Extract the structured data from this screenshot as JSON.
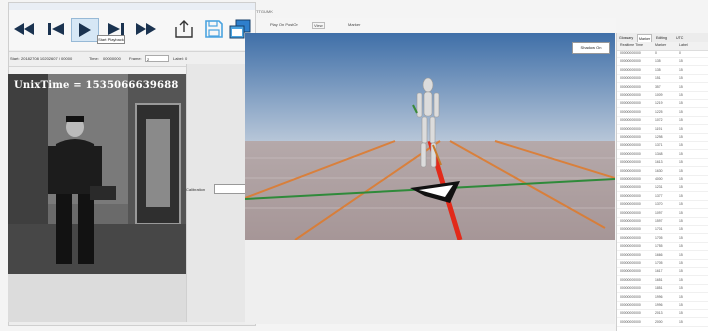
{
  "left_window": {
    "title": "",
    "toolbar": {
      "rewind_icon": "fast-backward-icon",
      "prev_icon": "skip-back-icon",
      "play_icon": "play-icon",
      "next_icon": "skip-forward-icon",
      "forward_icon": "fast-forward-icon",
      "export_icon": "export-icon",
      "save_icon": "save-icon",
      "window_icon": "window-icon",
      "tooltip": "Start Playback"
    },
    "info": {
      "start_label": "Start:",
      "start_value": "20182708 10202607 / 00000",
      "time_label": "Time:",
      "time_value": "00000000",
      "frame_label": "Frame:",
      "frame_value": "2",
      "label_text": "Label: 0"
    },
    "path_text": "",
    "unix_time": "UnixTime = 1535066639688",
    "calibration_label": "Calibration"
  },
  "viewer": {
    "title": "TTGUMK",
    "menu": [
      "Play On PostOr",
      "View",
      "Marker"
    ],
    "shadow_button": "Shadow On"
  },
  "right_panel": {
    "tabs": [
      "Glossary",
      "Marker",
      "Editing",
      "UTC"
    ],
    "active_tab": 1,
    "headers": [
      "Realtime Time",
      "Marker",
      "Label"
    ],
    "rows": [
      [
        "00000000000",
        "0",
        "0"
      ],
      [
        "00000000000",
        "135",
        "15"
      ],
      [
        "00000000000",
        "135",
        "15"
      ],
      [
        "00000000000",
        "151",
        "15"
      ],
      [
        "00000000000",
        "357",
        "15"
      ],
      [
        "00000000000",
        "1009",
        "15"
      ],
      [
        "00000000000",
        "1219",
        "15"
      ],
      [
        "00000000000",
        "1225",
        "15"
      ],
      [
        "00000000000",
        "1072",
        "15"
      ],
      [
        "00000000000",
        "1191",
        "15"
      ],
      [
        "00000000000",
        "1298",
        "15"
      ],
      [
        "00000000000",
        "1371",
        "15"
      ],
      [
        "00000000000",
        "1348",
        "15"
      ],
      [
        "00000000000",
        "1613",
        "15"
      ],
      [
        "00000000000",
        "1630",
        "15"
      ],
      [
        "00000000000",
        "4000",
        "15"
      ],
      [
        "00000000000",
        "1231",
        "15"
      ],
      [
        "00000000000",
        "1377",
        "15"
      ],
      [
        "00000000000",
        "1370",
        "15"
      ],
      [
        "00000000000",
        "1097",
        "15"
      ],
      [
        "00000000000",
        "1597",
        "15"
      ],
      [
        "00000000000",
        "1701",
        "15"
      ],
      [
        "00000000000",
        "1705",
        "15"
      ],
      [
        "00000000000",
        "1755",
        "15"
      ],
      [
        "00000000000",
        "1666",
        "15"
      ],
      [
        "00000000000",
        "1705",
        "15"
      ],
      [
        "00000000000",
        "1617",
        "15"
      ],
      [
        "00000000000",
        "1651",
        "15"
      ],
      [
        "00000000000",
        "1851",
        "15"
      ],
      [
        "00000000000",
        "1996",
        "15"
      ],
      [
        "00000000000",
        "1996",
        "15"
      ],
      [
        "00000000000",
        "2013",
        "15"
      ],
      [
        "00000000000",
        "2000",
        "15"
      ]
    ]
  }
}
